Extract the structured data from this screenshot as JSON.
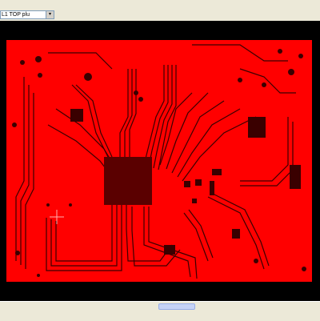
{
  "toolbar": {
    "layer_select_value": "L1 TOP plu",
    "layer_select_arrow": "▾"
  },
  "canvas": {
    "board_color": "#ff0000",
    "background_color": "#000000",
    "trace_color": "#3a0000"
  },
  "icons": {
    "dropdown": "chevron-down-icon",
    "cursor": "crosshair-cursor-icon"
  }
}
